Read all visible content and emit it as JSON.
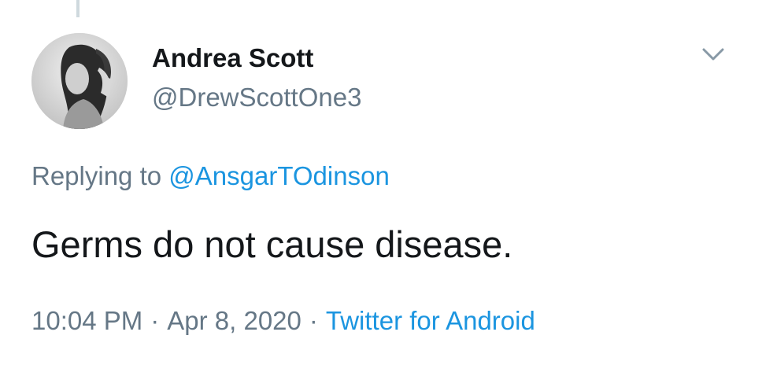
{
  "author": {
    "name": "Andrea Scott",
    "handle": "@DrewScottOne3"
  },
  "reply": {
    "prefix": "Replying to ",
    "mention": "@AnsgarTOdinson"
  },
  "tweet": {
    "text": "Germs do not cause disease."
  },
  "meta": {
    "time": "10:04 PM",
    "separator": "·",
    "date": "Apr 8, 2020",
    "source": "Twitter for Android"
  },
  "icons": {
    "menu": "chevron-down-icon"
  },
  "colors": {
    "text": "#14171a",
    "secondary": "#657786",
    "link": "#1b95e0"
  }
}
